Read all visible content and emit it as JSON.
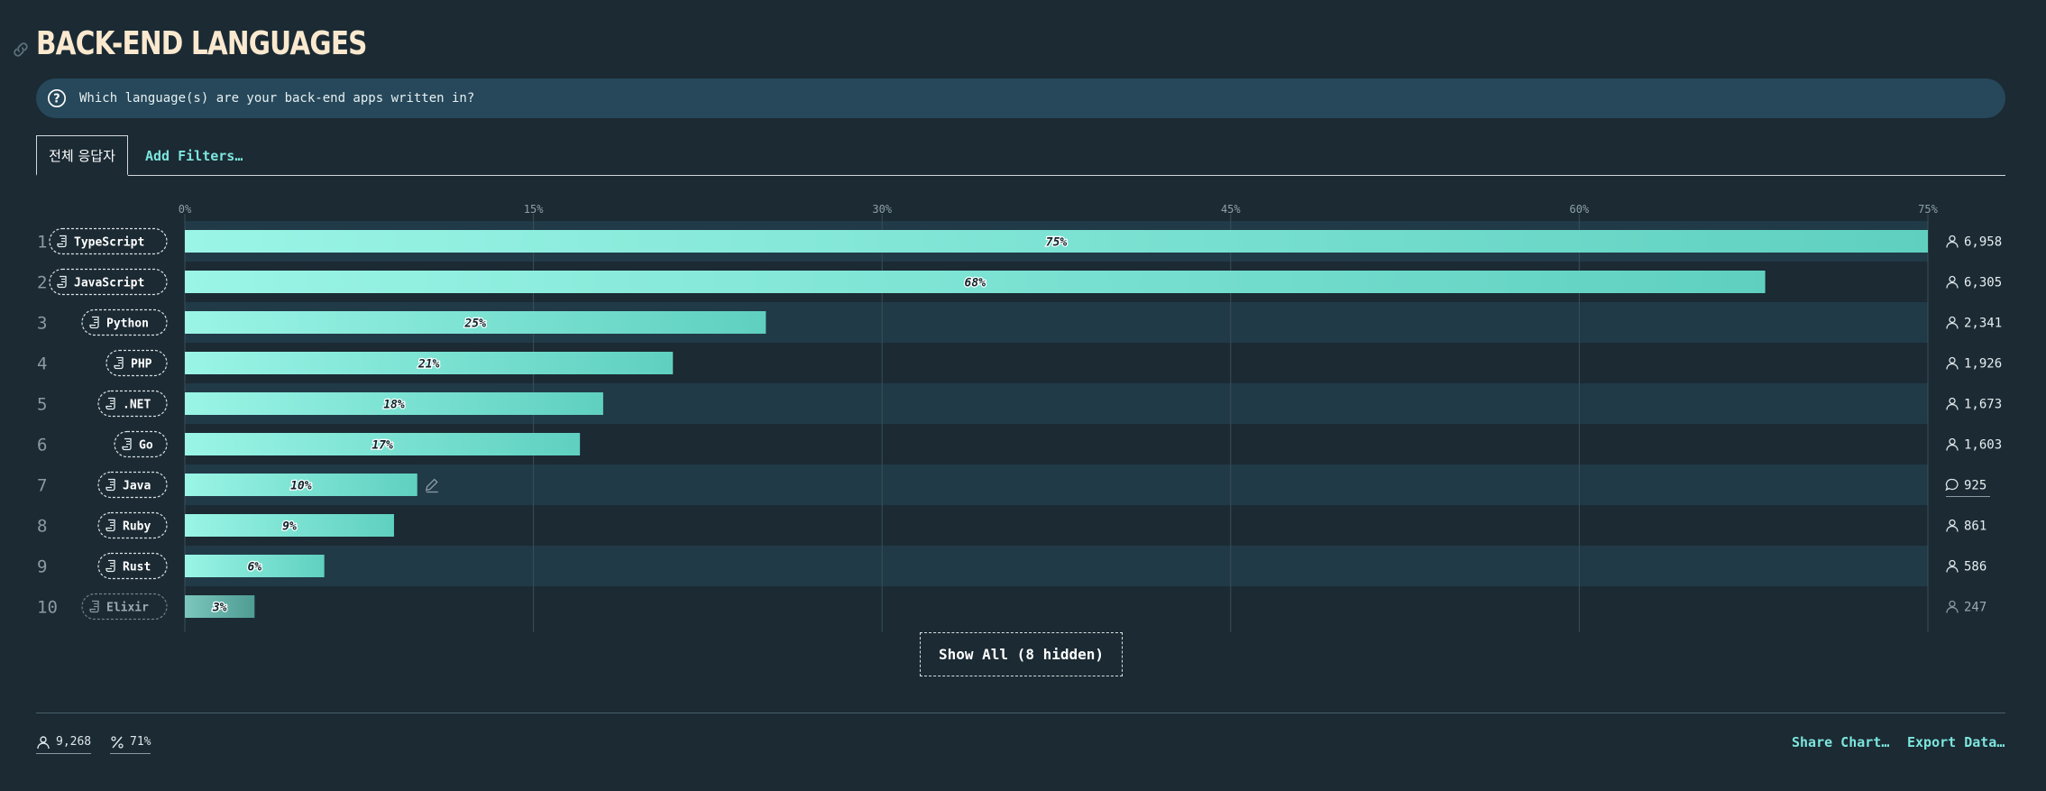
{
  "header": {
    "title": "BACK-END LANGUAGES",
    "link_icon": "link-icon"
  },
  "question": {
    "icon": "question-circle-icon",
    "text": "Which language(s) are your back-end apps written in?"
  },
  "tabs": {
    "active_label": "전체 응답자",
    "filters_label": "Add Filters…"
  },
  "chart_data": {
    "type": "bar",
    "orientation": "horizontal",
    "xlim": [
      0,
      75
    ],
    "ticks": [
      "0%",
      "15%",
      "30%",
      "45%",
      "60%",
      "75%"
    ],
    "tick_values": [
      0,
      15,
      30,
      45,
      60,
      75
    ],
    "grid": true,
    "categories": [
      "TypeScript",
      "JavaScript",
      "Python",
      "PHP",
      ".NET",
      "Go",
      "Java",
      "Ruby",
      "Rust",
      "Elixir"
    ],
    "values": [
      75,
      68,
      25,
      21,
      18,
      17,
      10,
      9,
      6,
      3
    ],
    "value_labels": [
      "75%",
      "68%",
      "25%",
      "21%",
      "18%",
      "17%",
      "10%",
      "9%",
      "6%",
      "3%"
    ],
    "ranks": [
      "1",
      "2",
      "3",
      "4",
      "5",
      "6",
      "7",
      "8",
      "9",
      "10"
    ],
    "counts": [
      "6,958",
      "6,305",
      "2,341",
      "1,926",
      "1,673",
      "1,603",
      "925",
      "861",
      "586",
      "247"
    ],
    "count_icons": [
      "person-icon",
      "person-icon",
      "person-icon",
      "person-icon",
      "person-icon",
      "person-icon",
      "comment-icon",
      "person-icon",
      "person-icon",
      "person-icon"
    ],
    "label_icon": "scroll-icon",
    "colors": {
      "bar_start": "#9af5e6",
      "bar_end": "#5fd0c0",
      "bar_dim_start": "#7cc6bd",
      "bar_dim_end": "#4e9c93",
      "row_alt": "#213a48"
    }
  },
  "show_all": {
    "label": "Show All (8 hidden)"
  },
  "footer": {
    "respondents": "9,268",
    "respondents_icon": "person-icon",
    "percentage": "71%",
    "percentage_icon": "percent-icon",
    "share_label": "Share Chart…",
    "export_label": "Export Data…"
  }
}
